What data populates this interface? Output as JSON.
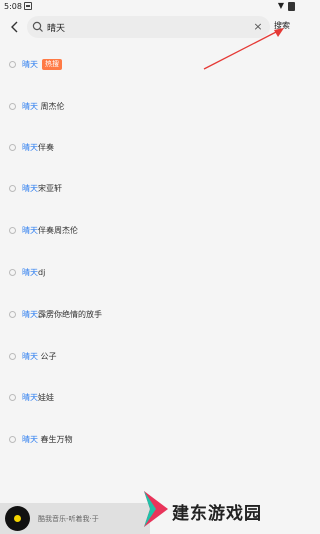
{
  "status_bar": {
    "time": "5:08"
  },
  "search": {
    "value": "晴天",
    "action_label": "搜索"
  },
  "suggestions": [
    {
      "highlight": "晴天",
      "rest": "",
      "badge": "热搜"
    },
    {
      "highlight": "晴天",
      "rest": " 周杰伦",
      "badge": ""
    },
    {
      "highlight": "晴天",
      "rest": "伴奏",
      "badge": ""
    },
    {
      "highlight": "晴天",
      "rest": "宋亚轩",
      "badge": ""
    },
    {
      "highlight": "晴天",
      "rest": "伴奏周杰伦",
      "badge": ""
    },
    {
      "highlight": "晴天",
      "rest": "dj",
      "badge": ""
    },
    {
      "highlight": "晴天",
      "rest": "霹雳你绝情的放手",
      "badge": ""
    },
    {
      "highlight": "晴天",
      "rest": " 公子",
      "badge": ""
    },
    {
      "highlight": "晴天",
      "rest": "娃娃",
      "badge": ""
    },
    {
      "highlight": "晴天",
      "rest": " 春生万物",
      "badge": ""
    }
  ],
  "player": {
    "text": "酷我音乐-听着我·于"
  },
  "watermark": {
    "text": "建东游戏园"
  },
  "colors": {
    "highlight": "#2f7ff0",
    "badge": "#ff7a45",
    "annotation": "#e53935"
  }
}
